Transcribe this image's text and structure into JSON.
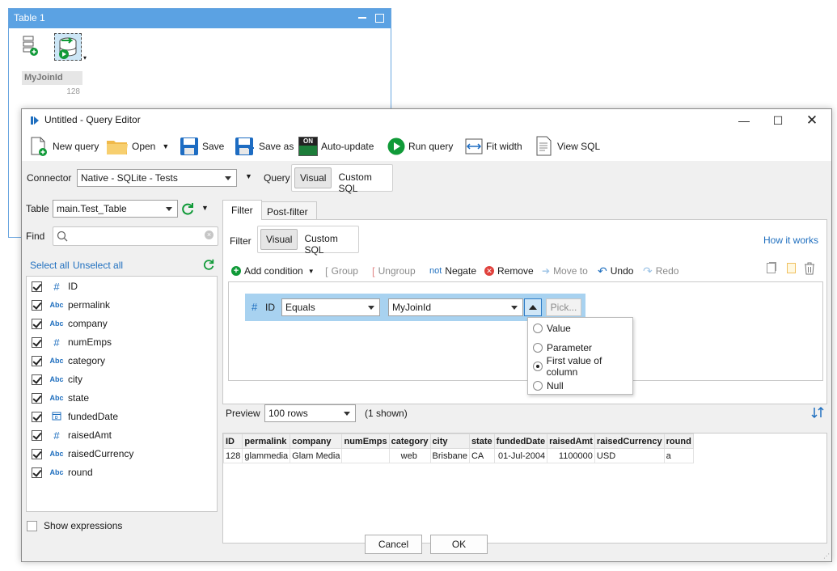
{
  "background_window": {
    "title": "Table 1",
    "column_header": "MyJoinId",
    "column_value": "128"
  },
  "dialog": {
    "title": "Untitled -  Query Editor",
    "toolbar": {
      "new_query": "New query",
      "open": "Open",
      "save": "Save",
      "save_as": "Save as",
      "auto_update": "Auto-update",
      "auto_update_badge": "ON",
      "run_query": "Run query",
      "fit_width": "Fit width",
      "view_sql": "View SQL"
    },
    "connector": {
      "label": "Connector",
      "value": "Native - SQLite - Tests",
      "query_label": "Query",
      "query_modes": [
        "Visual",
        "Custom SQL"
      ]
    },
    "left": {
      "table_label": "Table",
      "table_value": "main.Test_Table",
      "find_label": "Find",
      "find_value": "",
      "select_all": "Select all",
      "unselect_all": "Unselect all",
      "columns": [
        {
          "type": "#",
          "name": "ID",
          "checked": true
        },
        {
          "type": "Abc",
          "name": "permalink",
          "checked": true
        },
        {
          "type": "Abc",
          "name": "company",
          "checked": true
        },
        {
          "type": "#",
          "name": "numEmps",
          "checked": true
        },
        {
          "type": "Abc",
          "name": "category",
          "checked": true
        },
        {
          "type": "Abc",
          "name": "city",
          "checked": true
        },
        {
          "type": "Abc",
          "name": "state",
          "checked": true
        },
        {
          "type": "date",
          "name": "fundedDate",
          "checked": true
        },
        {
          "type": "#",
          "name": "raisedAmt",
          "checked": true
        },
        {
          "type": "Abc",
          "name": "raisedCurrency",
          "checked": true
        },
        {
          "type": "Abc",
          "name": "round",
          "checked": true
        }
      ],
      "show_expressions": "Show expressions"
    },
    "tabs": [
      "Filter",
      "Post-filter"
    ],
    "filter": {
      "label": "Filter",
      "modes": [
        "Visual",
        "Custom SQL"
      ],
      "help_link": "How it works",
      "actions": {
        "add_condition": "Add condition",
        "group": "Group",
        "ungroup": "Ungroup",
        "negate_prefix": "not",
        "negate": "Negate",
        "remove": "Remove",
        "move_to": "Move to",
        "undo": "Undo",
        "redo": "Redo"
      },
      "condition": {
        "field_type": "#",
        "field": "ID",
        "operator": "Equals",
        "value": "MyJoinId",
        "pick": "Pick..."
      },
      "value_source_options": [
        "Value",
        "Parameter",
        "First value of column",
        "Null"
      ],
      "value_source_selected": "First value of column"
    },
    "preview": {
      "label": "Preview",
      "rows_value": "100 rows",
      "shown": "(1 shown)",
      "columns": [
        "ID",
        "permalink",
        "company",
        "numEmps",
        "category",
        "city",
        "state",
        "fundedDate",
        "raisedAmt",
        "raisedCurrency",
        "round"
      ],
      "rows": [
        [
          "128",
          "glammedia",
          "Glam Media",
          "",
          "web",
          "Brisbane",
          "CA",
          "01-Jul-2004",
          "1100000",
          "USD",
          "a"
        ]
      ]
    },
    "buttons": {
      "cancel": "Cancel",
      "ok": "OK"
    }
  },
  "colors": {
    "accent_blue": "#1f6fbf",
    "condition_highlight": "#a8d2f0",
    "run_green": "#109a38",
    "remove_red": "#e0413c"
  }
}
